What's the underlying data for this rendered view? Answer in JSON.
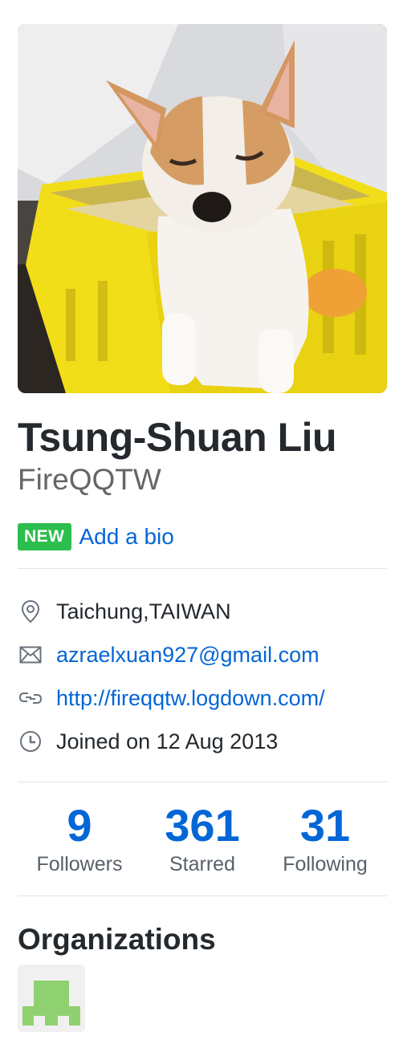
{
  "profile": {
    "avatar_alt": "Chihuahua sitting in a yellow crate",
    "fullname": "Tsung-Shuan Liu",
    "username": "FireQQTW",
    "new_badge": "NEW",
    "add_bio": "Add a bio"
  },
  "details": {
    "location": "Taichung,TAIWAN",
    "email": "azraelxuan927@gmail.com",
    "website": "http://fireqqtw.logdown.com/",
    "joined": "Joined on 12 Aug 2013"
  },
  "stats": [
    {
      "value": "9",
      "label": "Followers"
    },
    {
      "value": "361",
      "label": "Starred"
    },
    {
      "value": "31",
      "label": "Following"
    }
  ],
  "organizations": {
    "heading": "Organizations"
  },
  "colors": {
    "link": "#0366d6",
    "badge": "#2cbe4e",
    "org_identicon": "#8fd170"
  },
  "icons": {
    "location": "location-pin-icon",
    "email": "mail-icon",
    "website": "link-icon",
    "joined": "clock-icon"
  }
}
